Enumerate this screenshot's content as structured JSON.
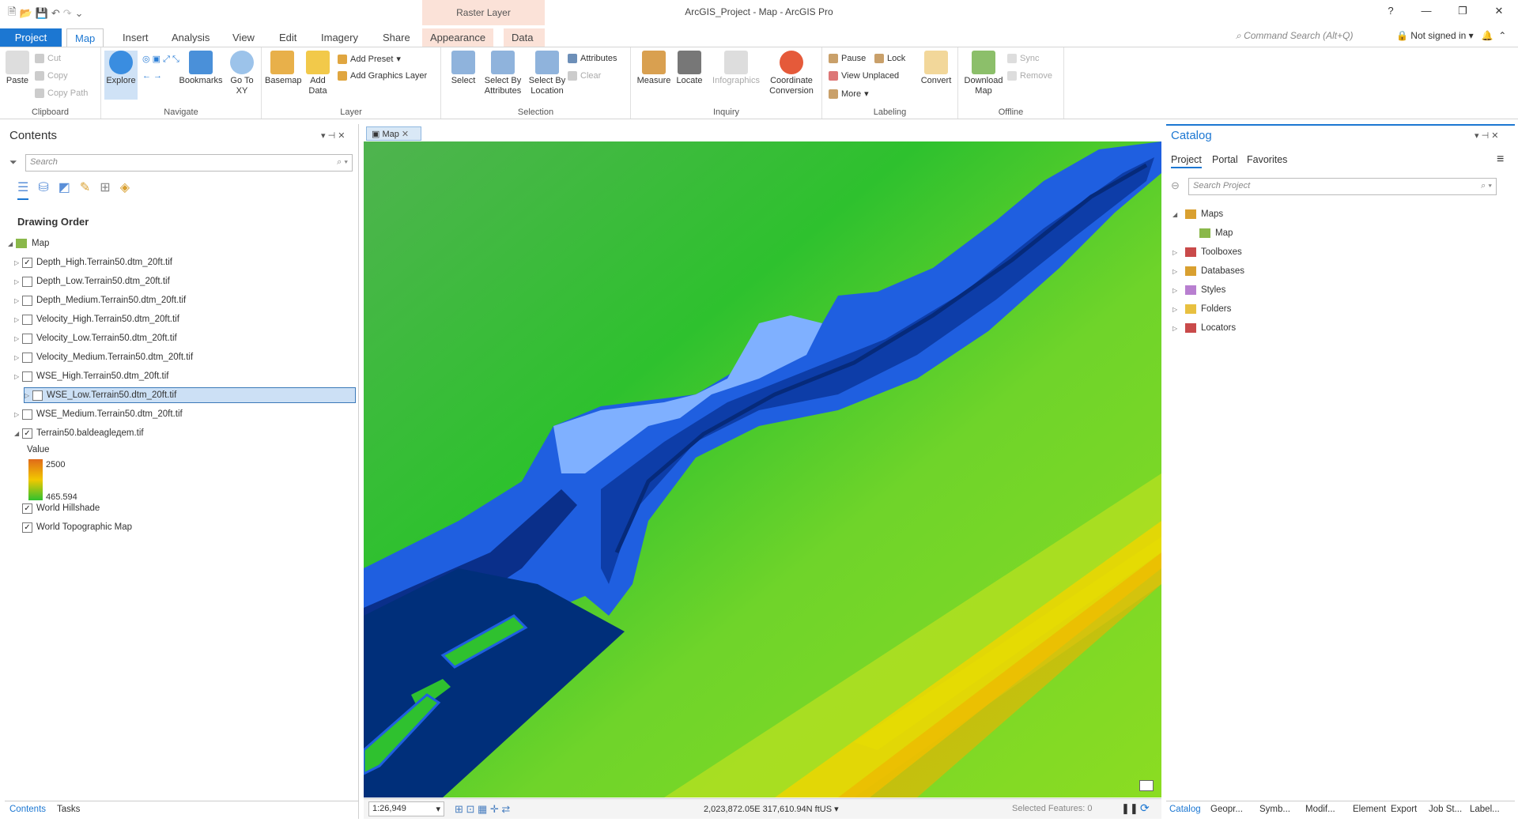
{
  "app": {
    "title": "ArcGIS_Project - Map - ArcGIS Pro",
    "context_tab_group": "Raster Layer",
    "command_search_placeholder": "Command Search (Alt+Q)",
    "signin": "Not signed in"
  },
  "tabs": [
    "Project",
    "Map",
    "Insert",
    "Analysis",
    "View",
    "Edit",
    "Imagery",
    "Share",
    "Appearance",
    "Data"
  ],
  "ribbon": {
    "clipboard": {
      "label": "Clipboard",
      "paste": "Paste",
      "cut": "Cut",
      "copy": "Copy",
      "copy_path": "Copy Path"
    },
    "navigate": {
      "label": "Navigate",
      "explore": "Explore",
      "bookmarks": "Bookmarks",
      "goto": "Go To XY"
    },
    "layer": {
      "label": "Layer",
      "basemap": "Basemap",
      "add_data": "Add Data",
      "add_preset": "Add Preset",
      "add_graphics": "Add Graphics Layer"
    },
    "selection": {
      "label": "Selection",
      "select": "Select",
      "by_attr": "Select By Attributes",
      "by_loc": "Select By Location",
      "attributes": "Attributes",
      "clear": "Clear"
    },
    "inquiry": {
      "label": "Inquiry",
      "measure": "Measure",
      "locate": "Locate",
      "infographics": "Infographics",
      "coord": "Coordinate Conversion"
    },
    "labeling": {
      "label": "Labeling",
      "pause": "Pause",
      "lock": "Lock",
      "view_unplaced": "View Unplaced",
      "more": "More",
      "convert": "Convert"
    },
    "offline": {
      "label": "Offline",
      "download": "Download Map",
      "sync": "Sync",
      "remove": "Remove"
    }
  },
  "contents": {
    "title": "Contents",
    "search_placeholder": "Search",
    "drawing_order": "Drawing Order",
    "map_label": "Map",
    "layers": [
      {
        "name": "Depth_High.Terrain50.dtm_20ft.tif",
        "checked": "✓"
      },
      {
        "name": "Depth_Low.Terrain50.dtm_20ft.tif",
        "checked": ""
      },
      {
        "name": "Depth_Medium.Terrain50.dtm_20ft.tif",
        "checked": ""
      },
      {
        "name": "Velocity_High.Terrain50.dtm_20ft.tif",
        "checked": ""
      },
      {
        "name": "Velocity_Low.Terrain50.dtm_20ft.tif",
        "checked": ""
      },
      {
        "name": "Velocity_Medium.Terrain50.dtm_20ft.tif",
        "checked": ""
      },
      {
        "name": "WSE_High.Terrain50.dtm_20ft.tif",
        "checked": ""
      },
      {
        "name": "WSE_Low.Terrain50.dtm_20ft.tif",
        "checked": ""
      },
      {
        "name": "WSE_Medium.Terrain50.dtm_20ft.tif",
        "checked": ""
      },
      {
        "name": "Terrain50.baldeaglедem.tif",
        "checked": "✓"
      }
    ],
    "legend_title": "Value",
    "legend_max": "2500",
    "legend_min": "465.594",
    "basemaps": [
      "World Hillshade",
      "World Topographic Map"
    ],
    "bottom_tabs": [
      "Contents",
      "Tasks"
    ]
  },
  "map": {
    "tab": "Map",
    "scale": "1:26,949",
    "coords": "2,023,872.05E 317,610.94N ftUS",
    "selected_features": "Selected Features: 0"
  },
  "catalog": {
    "title": "Catalog",
    "tabs": [
      "Project",
      "Portal",
      "Favorites"
    ],
    "search_placeholder": "Search Project",
    "items": [
      "Maps",
      "Map",
      "Toolboxes",
      "Databases",
      "Styles",
      "Folders",
      "Locators"
    ],
    "bottom_tabs": [
      "Catalog",
      "Geopr...",
      "Symb...",
      "Modif...",
      "Element",
      "Export",
      "Job St...",
      "Label..."
    ]
  },
  "colors": {
    "accent": "#1c77d2",
    "context": "#fbe2d8",
    "water_deep": "#003b8f",
    "water_mid": "#1f5fe0",
    "water_light": "#7fb0ff",
    "terrain_low": "#2fc12f",
    "terrain_high": "#f2c800"
  }
}
